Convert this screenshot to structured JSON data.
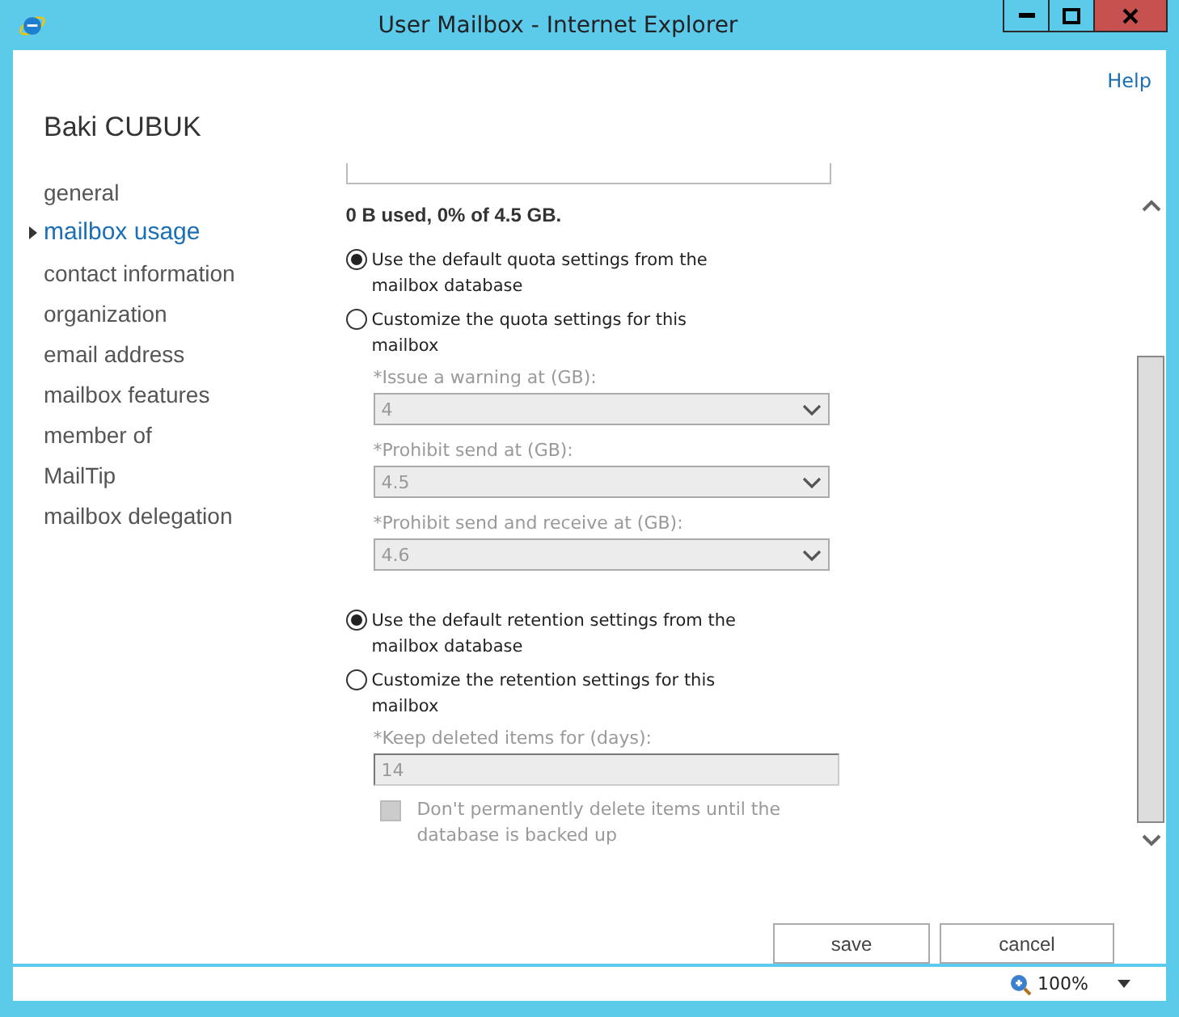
{
  "window": {
    "title": "User Mailbox - Internet Explorer"
  },
  "help": "Help",
  "user_name": "Baki CUBUK",
  "nav": [
    {
      "label": "general",
      "selected": false
    },
    {
      "label": "mailbox usage",
      "selected": true
    },
    {
      "label": "contact information",
      "selected": false
    },
    {
      "label": "organization",
      "selected": false
    },
    {
      "label": "email address",
      "selected": false
    },
    {
      "label": "mailbox features",
      "selected": false
    },
    {
      "label": "member of",
      "selected": false
    },
    {
      "label": "MailTip",
      "selected": false
    },
    {
      "label": "mailbox delegation",
      "selected": false
    }
  ],
  "usage": "0 B used, 0% of 4.5 GB.",
  "quota_options": [
    {
      "label": "Use the default quota settings from the mailbox database",
      "selected": true
    },
    {
      "label": "Customize the quota settings for this mailbox",
      "selected": false
    }
  ],
  "quota_fields": [
    {
      "label": "*Issue a warning at (GB):",
      "value": "4",
      "disabled": true
    },
    {
      "label": "*Prohibit send at (GB):",
      "value": "4.5",
      "disabled": true
    },
    {
      "label": "*Prohibit send and receive at (GB):",
      "value": "4.6",
      "disabled": true
    }
  ],
  "retention_options": [
    {
      "label": "Use the default retention settings from the mailbox database",
      "selected": true
    },
    {
      "label": "Customize the retention settings for this mailbox",
      "selected": false
    }
  ],
  "retention_field": {
    "label": "*Keep deleted items for (days):",
    "value": "14",
    "disabled": true
  },
  "backup_checkbox": {
    "label": "Don't permanently delete items until the database is backed up",
    "checked": false,
    "disabled": true
  },
  "buttons": [
    "save",
    "cancel"
  ],
  "zoom": "100%"
}
